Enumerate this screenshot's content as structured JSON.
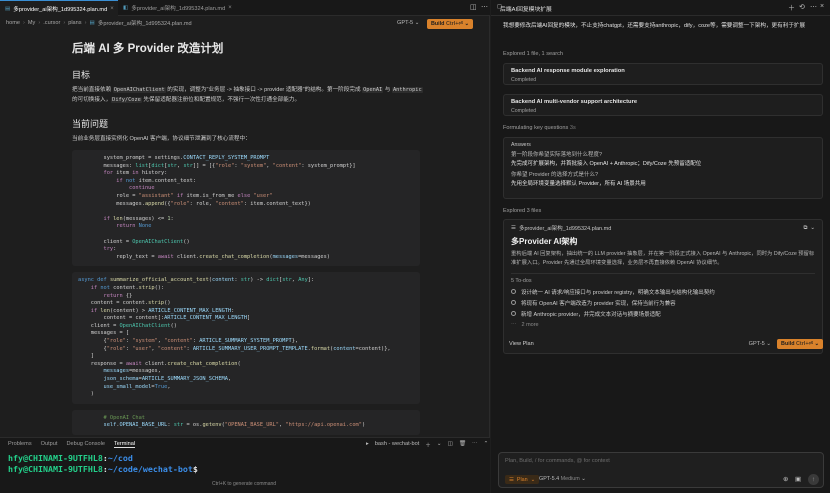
{
  "editor": {
    "tabs": [
      {
        "label": "多provider_ai架构_1d995324.plan.md",
        "active": true
      },
      {
        "label": "多provider_ai架构_1d995324.plan.md",
        "active": false
      }
    ],
    "breadcrumbs": [
      "home",
      "My",
      ".cursor",
      "plans",
      "多provider_ai架构_1d995324.plan.md"
    ],
    "model": "GPT-5",
    "build_label": "Build",
    "build_shortcut": "Ctrl+⏎",
    "title": "后端 AI 多 Provider 改造计划",
    "sections": [
      {
        "heading": "目标",
        "parts": [
          {
            "t": "text",
            "v": "把当前直接依赖 "
          },
          {
            "t": "code",
            "v": "OpenAIChatClient"
          },
          {
            "t": "text",
            "v": " 的实现，调整为\"业务层 -> 抽象接口 -> provider 适配器\"的结构。第一阶段完成 "
          },
          {
            "t": "code",
            "v": "OpenAI"
          },
          {
            "t": "text",
            "v": " 与 "
          },
          {
            "t": "code",
            "v": "Anthropic"
          },
          {
            "t": "text",
            "v": " 的可切换接入，"
          },
          {
            "t": "code",
            "v": "Dify/Coze"
          },
          {
            "t": "text",
            "v": " 先保留适配器注册位和配置规范，不强行一次性打通全部能力。"
          }
        ]
      },
      {
        "heading": "当前问题",
        "parts": [
          {
            "t": "text",
            "v": "当前业务层直接实例化 OpenAI 客户端，协议细节泄漏到了核心流程中："
          }
        ]
      }
    ]
  },
  "panel": {
    "tabs": [
      "Problems",
      "Output",
      "Debug Console",
      "Terminal"
    ],
    "active_tab": "Terminal",
    "terminal_name": "bash - wechat-bot",
    "lines": [
      {
        "user": "hfy@CHINAMI-9UTFHL8",
        "path": "~/cod"
      },
      {
        "user": "hfy@CHINAMI-9UTFHL8",
        "path": "~/code/wechat-bot"
      }
    ],
    "hint": "Ctrl+K to generate command"
  },
  "chat": {
    "title": "后端AI回复模块扩展",
    "user_message": "我想要修改后端AI回复的模块，不止支持chatgpt，还需要支持anthropic，dify，coze等，需要调整一下架构，更有利于扩展",
    "explored_1": "Explored 1 file, 1 search",
    "tasks": [
      {
        "title": "Backend AI response module exploration",
        "status": "Completed"
      },
      {
        "title": "Backend AI multi-vendor support architecture",
        "status": "Completed"
      }
    ],
    "formulating": "Formulating key questions",
    "formulating_time": "3s",
    "answers_label": "Answers",
    "qa": [
      {
        "q": "第一阶段你希望实际落地到什么程度?",
        "a": "先完成可扩展架构，并首批接入 OpenAI + Anthropic；Dify/Coze 先预留适配位"
      },
      {
        "q": "你希望 Provider 的选择方式是什么?",
        "a": "先用全局环境变量选择默认 Provider，所有 AI 场景共用"
      }
    ],
    "explored_2": "Explored 3 files",
    "plan_file": "多provider_ai架构_1d995324.plan.md",
    "plan_title": "多Provider AI架构",
    "plan_summary": "重构后端 AI 回复架构，抽出统一的 LLM provider 抽象层，并在第一阶段正式接入 OpenAI 与 Anthropic，同时为 Dify/Coze 预留标准扩展入口。Provider 先通过全局环境变量选择，业务层不再直接依赖 OpenAI 协议细节。",
    "todos_label": "5 To-dos",
    "todos": [
      "设计统一 AI 请求/响应接口与 provider registry，明确文本输出与结构化输出契约",
      "将现有 OpenAI 客户端改造为 provider 实现，保持当前行为兼容",
      "新增 Anthropic provider，并完成文本对话与摘要场景适配"
    ],
    "more_label": "2 more",
    "view_plan": "View Plan",
    "model": "GPT-5",
    "build_label": "Build",
    "build_shortcut": "Ctrl+⏎",
    "input_placeholder": "Plan, Build, / for commands, @ for context",
    "mode": "Plan",
    "input_model": "GPT-5.4",
    "input_model_note": "Medium"
  },
  "colors": {
    "accent": "#d9822b",
    "terminal_user": "#23d18b",
    "terminal_path": "#3b8eea"
  }
}
